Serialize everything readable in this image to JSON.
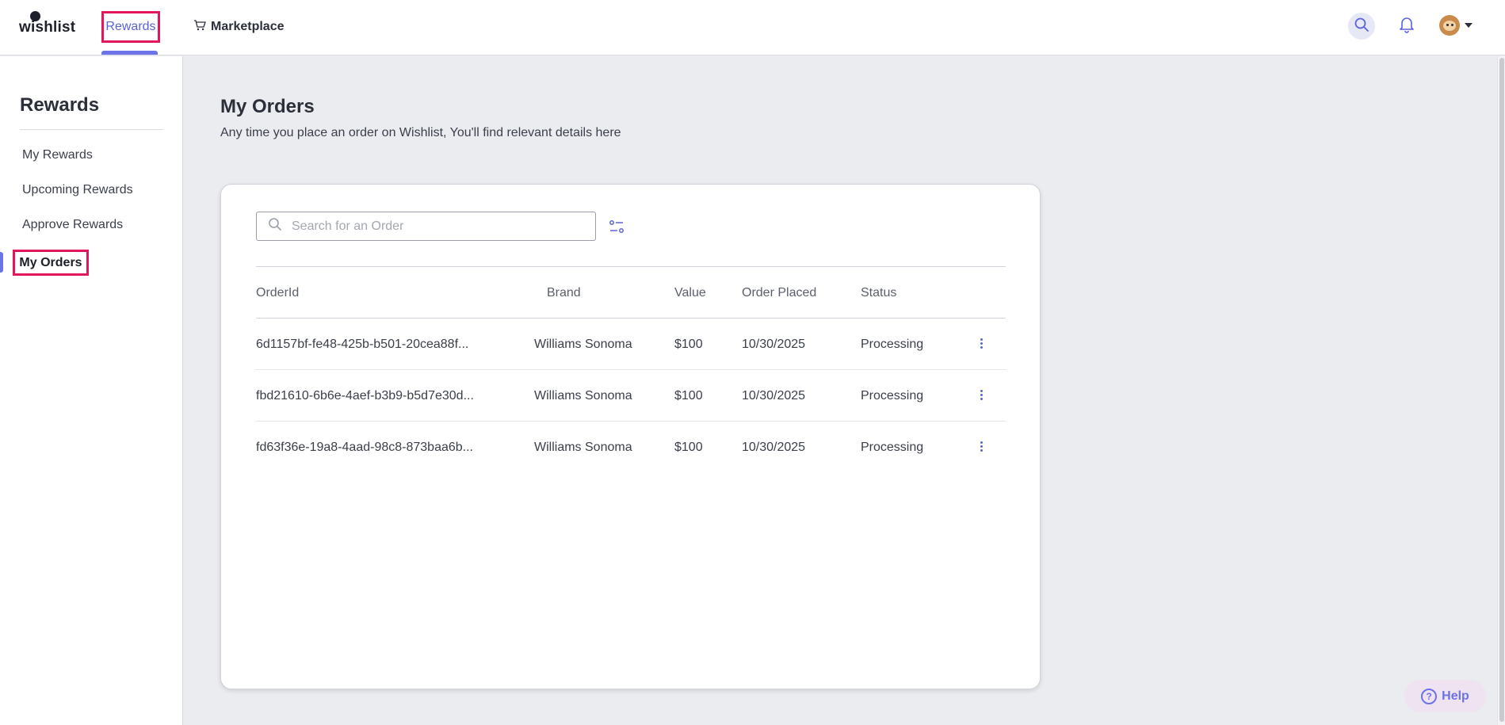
{
  "topnav": {
    "logo_text": "wishlist",
    "rewards_label": "Rewards",
    "marketplace_label": "Marketplace",
    "accent_color": "#6b73e6",
    "highlight_color": "#e3165b"
  },
  "sidebar": {
    "title": "Rewards",
    "items": [
      {
        "label": "My Rewards"
      },
      {
        "label": "Upcoming Rewards"
      },
      {
        "label": "Approve Rewards"
      },
      {
        "label": "My Orders",
        "active": true
      }
    ]
  },
  "main": {
    "title": "My Orders",
    "subtitle": "Any time you place an order on Wishlist, You'll find relevant details here",
    "search": {
      "placeholder": "Search for an Order",
      "value": ""
    },
    "table": {
      "columns": [
        "OrderId",
        "Brand",
        "Value",
        "Order Placed",
        "Status"
      ],
      "rows": [
        {
          "order_id": "6d1157bf-fe48-425b-b501-20cea88f...",
          "brand": "Williams Sonoma",
          "value": "$100",
          "order_placed": "10/30/2025",
          "status": "Processing"
        },
        {
          "order_id": "fbd21610-6b6e-4aef-b3b9-b5d7e30d...",
          "brand": "Williams Sonoma",
          "value": "$100",
          "order_placed": "10/30/2025",
          "status": "Processing"
        },
        {
          "order_id": "fd63f36e-19a8-4aad-98c8-873baa6b...",
          "brand": "Williams Sonoma",
          "value": "$100",
          "order_placed": "10/30/2025",
          "status": "Processing"
        }
      ]
    }
  },
  "help": {
    "label": "Help"
  },
  "icons": [
    "search-icon",
    "bell-icon",
    "cart-icon",
    "filter-icon",
    "kebab-menu-icon",
    "help-icon",
    "chevron-down-icon"
  ]
}
